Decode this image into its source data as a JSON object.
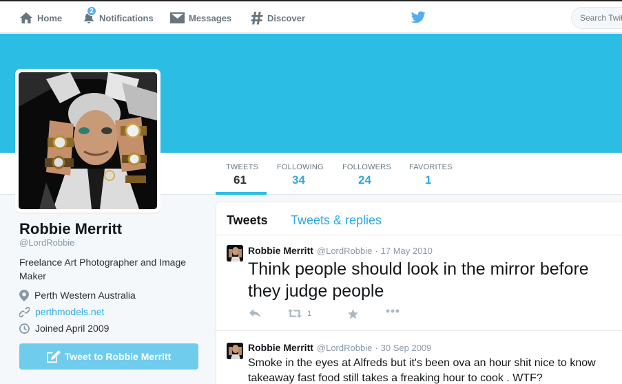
{
  "nav": {
    "home": "Home",
    "notifications": "Notifications",
    "notifications_badge": "2",
    "messages": "Messages",
    "discover": "Discover",
    "search_placeholder": "Search Twitter"
  },
  "colors": {
    "accent": "#2fa9e0",
    "banner": "#2cbde4",
    "tweet_button": "#6fccec"
  },
  "stats": {
    "tweets_label": "TWEETS",
    "tweets_value": "61",
    "following_label": "FOLLOWING",
    "following_value": "34",
    "followers_label": "FOLLOWERS",
    "followers_value": "24",
    "favorites_label": "FAVORITES",
    "favorites_value": "1"
  },
  "profile": {
    "name": "Robbie Merritt",
    "handle": "@LordRobbie",
    "bio": "Freelance Art Photographer and Image Maker",
    "location": "Perth Western Australia",
    "url": "perthmodels.net",
    "joined": "Joined April 2009",
    "tweet_to": "Tweet to Robbie Merritt"
  },
  "timeline": {
    "tab_tweets": "Tweets",
    "tab_replies": "Tweets & replies",
    "tweets": [
      {
        "name": "Robbie Merritt",
        "handle": "@LordRobbie",
        "date": "17 May 2010",
        "text": "Think people should look in the mirror before they judge people",
        "retweets": "1"
      },
      {
        "name": "Robbie Merritt",
        "handle": "@LordRobbie",
        "date": "30 Sep 2009",
        "text": "Smoke in the eyes at Alfreds but it's been ova an hour shit nice to know takeaway fast food still takes a freaking hour to cook . WTF?"
      }
    ]
  },
  "icons": [
    "home-icon",
    "bell-icon",
    "envelope-icon",
    "hashtag-icon",
    "twitter-bird-icon",
    "location-pin-icon",
    "link-icon",
    "clock-icon",
    "compose-icon",
    "reply-icon",
    "retweet-icon",
    "favorite-star-icon",
    "more-dots-icon"
  ]
}
